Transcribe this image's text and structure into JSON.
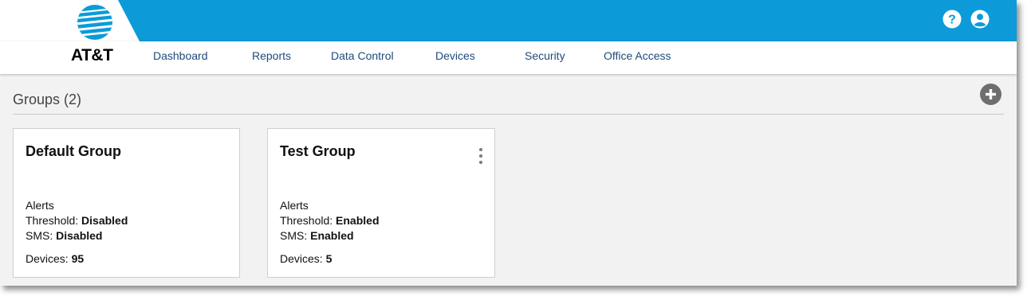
{
  "brand": {
    "logo_text": "AT&T",
    "logo_icon": "att-globe-icon",
    "colors": {
      "topbar": "#0c9bd8",
      "nav_text": "#1f4a7a"
    }
  },
  "header": {
    "icons": [
      "help-icon",
      "user-account-icon"
    ]
  },
  "nav": {
    "items": [
      {
        "label": "Dashboard"
      },
      {
        "label": "Reports"
      },
      {
        "label": "Data Control"
      },
      {
        "label": "Devices"
      },
      {
        "label": "Security"
      },
      {
        "label": "Office Access"
      }
    ]
  },
  "groups": {
    "title": "Groups (2)",
    "add_icon": "plus-circle-icon",
    "cards": [
      {
        "name": "Default Group",
        "alerts_label": "Alerts",
        "threshold_label": "Threshold:",
        "threshold_value": "Disabled",
        "sms_label": "SMS:",
        "sms_value": "Disabled",
        "devices_label": "Devices:",
        "devices_value": "95",
        "has_menu": false
      },
      {
        "name": "Test Group",
        "alerts_label": "Alerts",
        "threshold_label": "Threshold:",
        "threshold_value": "Enabled",
        "sms_label": "SMS:",
        "sms_value": "Enabled",
        "devices_label": "Devices:",
        "devices_value": "5",
        "has_menu": true,
        "menu_icon": "kebab-menu-icon"
      }
    ]
  }
}
